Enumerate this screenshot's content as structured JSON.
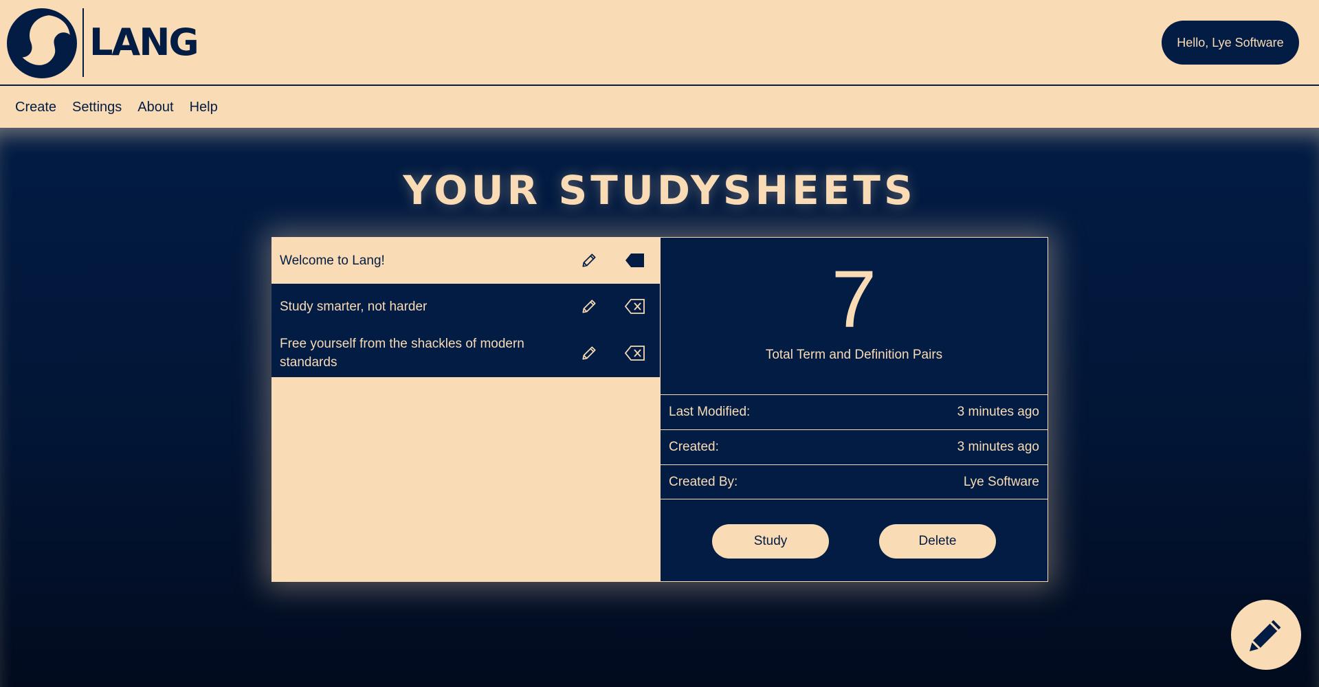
{
  "brand": {
    "name": "LANG"
  },
  "header": {
    "greeting": "Hello, Lye Software"
  },
  "nav": {
    "items": [
      {
        "label": "Create"
      },
      {
        "label": "Settings"
      },
      {
        "label": "About"
      },
      {
        "label": "Help"
      }
    ]
  },
  "main": {
    "title": "YOUR STUDYSHEETS"
  },
  "sheets": [
    {
      "title": "Welcome to Lang!",
      "selected": true
    },
    {
      "title": "Study smarter, not harder",
      "selected": false
    },
    {
      "title": "Free yourself from the shackles of modern standards",
      "selected": false
    }
  ],
  "detail": {
    "count": "7",
    "count_label": "Total Term and Definition Pairs",
    "rows": [
      {
        "label": "Last Modified:",
        "value": "3 minutes ago"
      },
      {
        "label": "Created:",
        "value": "3 minutes ago"
      },
      {
        "label": "Created By:",
        "value": "Lye Software"
      }
    ],
    "study_label": "Study",
    "delete_label": "Delete"
  },
  "icons": {
    "logo": "lang-logo-icon",
    "edit": "pencil-icon",
    "delete": "backspace-icon",
    "fab": "pencil-icon"
  },
  "colors": {
    "navy": "#021c44",
    "cream": "#f9dbb5"
  }
}
